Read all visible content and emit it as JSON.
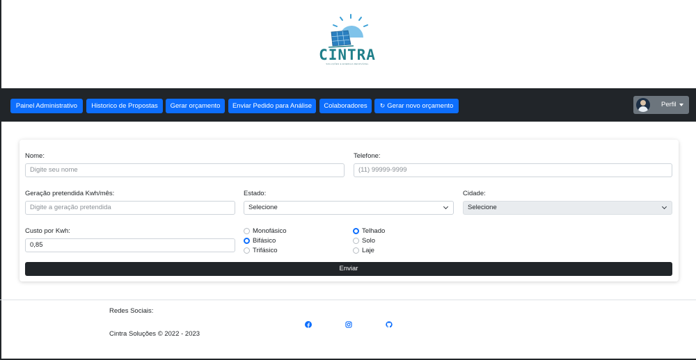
{
  "brand": {
    "name": "CINTRA",
    "tagline": "SOLUÇÕES E ENERGIA RENOVÁVEL",
    "colors": {
      "primary": "#1f7f8a",
      "accent": "#3a9fd6"
    }
  },
  "navbar": {
    "background": "#212529",
    "buttons": [
      {
        "label": "Painel Administrativo"
      },
      {
        "label": "Historico de Propostas"
      },
      {
        "label": "Gerar orçamento"
      },
      {
        "label": "Enviar Pedido para Análise"
      },
      {
        "label": "Colaboradores"
      },
      {
        "label": "Gerar novo orçamento",
        "icon": "refresh-icon"
      }
    ],
    "profile": {
      "label": "Perfil"
    }
  },
  "form": {
    "nome": {
      "label": "Nome:",
      "placeholder": "Digite seu nome"
    },
    "telefone": {
      "label": "Telefone:",
      "placeholder": "(11) 99999-9999"
    },
    "geracao": {
      "label": "Geração pretendida Kwh/mês:",
      "placeholder": "Digite a geração pretendida"
    },
    "estado": {
      "label": "Estado:",
      "selected": "Selecione"
    },
    "cidade": {
      "label": "Cidade:",
      "selected": "Selecione"
    },
    "custo": {
      "label": "Custo por Kwh:",
      "value": "0,85"
    },
    "fase": {
      "options": [
        "Monofásico",
        "Bifásico",
        "Trifásico"
      ],
      "selected": "Bifásico"
    },
    "instalacao": {
      "options": [
        "Telhado",
        "Solo",
        "Laje"
      ],
      "selected": "Telhado"
    },
    "submit_label": "Enviar"
  },
  "footer": {
    "social_title": "Redes Sociais:",
    "social_icons": [
      "facebook-icon",
      "instagram-icon",
      "github-icon"
    ],
    "copyright": "Cintra Soluções © 2022 - 2023"
  },
  "colors": {
    "primary_button": "#0d6efd",
    "dark": "#212529",
    "profile_button": "#6c757d"
  }
}
